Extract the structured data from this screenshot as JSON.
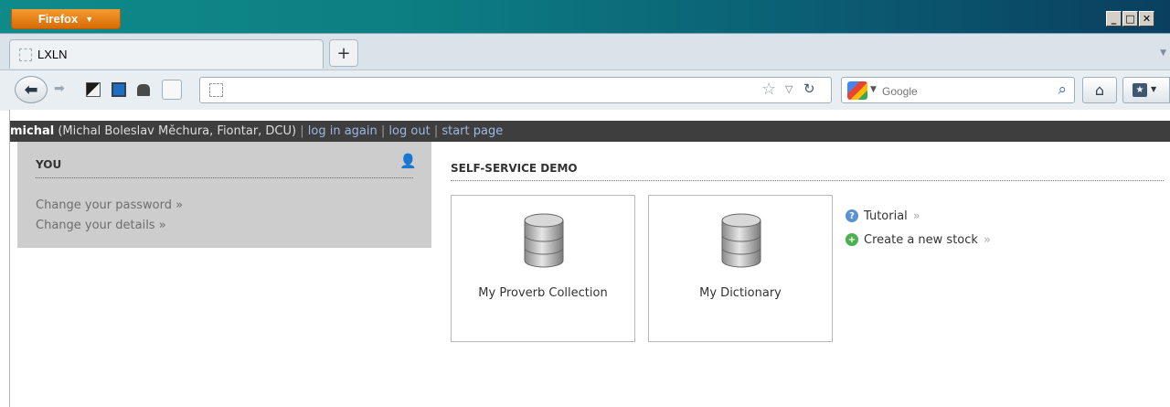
{
  "browser": {
    "menu_button": "Firefox",
    "window_controls": [
      "_",
      "□",
      "✕"
    ],
    "tab": {
      "label": "LXLN"
    },
    "new_tab": "+",
    "url": "",
    "search": {
      "engine": "Google",
      "placeholder": "Google"
    }
  },
  "page": {
    "userbar": {
      "username": "michal",
      "details": "(Michal Boleslav Měchura, Fiontar, DCU)",
      "sep": "|",
      "links": [
        "log in again",
        "log out",
        "start page"
      ]
    },
    "you_panel": {
      "heading": "YOU",
      "links": [
        "Change your password »",
        "Change your details »"
      ]
    },
    "demo": {
      "heading": "SELF-SERVICE DEMO",
      "cards": [
        "My Proverb Collection",
        "My Dictionary"
      ],
      "side_links": [
        {
          "label": "Tutorial",
          "icon": "help-icon",
          "color": "#5b8fd6"
        },
        {
          "label": "Create a new stock",
          "icon": "add-icon",
          "color": "#4caf50"
        }
      ],
      "arrow": "»"
    }
  }
}
